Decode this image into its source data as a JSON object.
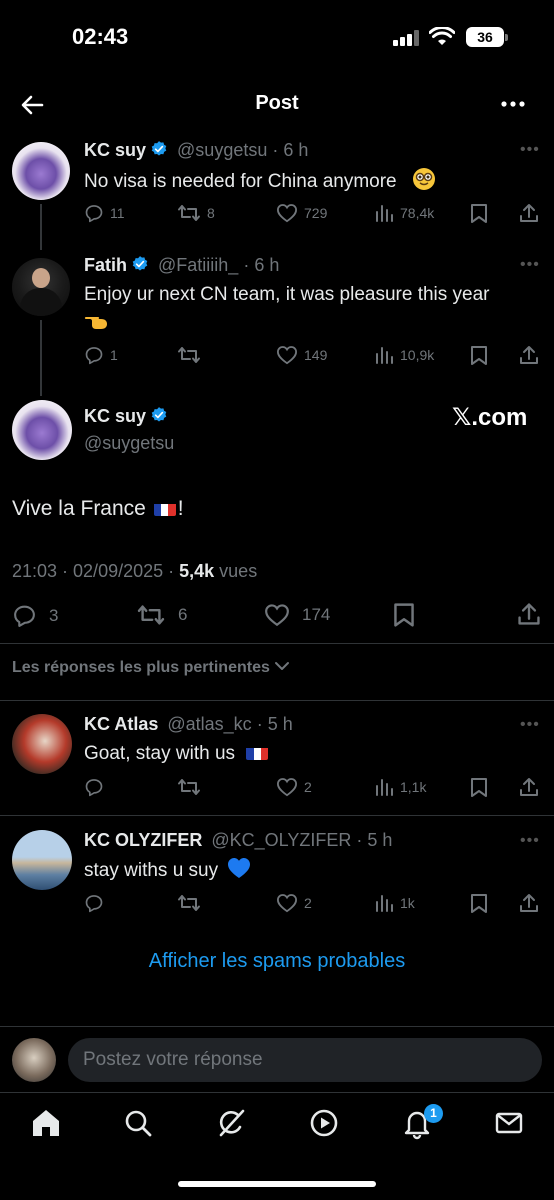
{
  "status_bar": {
    "time": "02:43",
    "battery": "36"
  },
  "header": {
    "title": "Post"
  },
  "colors": {
    "accent": "#1d9bf0",
    "background": "#000000",
    "muted": "#71767b"
  },
  "thread": [
    {
      "name": "KC suy",
      "handle": "@suygetsu",
      "time": "· 6 h",
      "text": "No visa is needed for China anymore",
      "emoji_icon": "nerd-face-icon",
      "stats": {
        "replies": "11",
        "reposts": "8",
        "likes": "729",
        "views": "78,4k"
      }
    },
    {
      "name": "Fatih",
      "handle": "@Fatiiiih_",
      "time": "· 6 h",
      "text": "Enjoy ur next CN team, it was pleasure this year",
      "emoji_icon": "pointing-hand-icon",
      "stats": {
        "replies": "1",
        "reposts": "",
        "likes": "149",
        "views": "10,9k"
      }
    }
  ],
  "main_post": {
    "name": "KC suy",
    "handle": "@suygetsu",
    "watermark": "𝕏.com",
    "text_before": "Vive la France",
    "text_after": "!",
    "timestamp": "21:03 · 02/09/2025 · ",
    "views_count": "5,4k",
    "views_label": " vues",
    "stats": {
      "replies": "3",
      "reposts": "6",
      "likes": "174"
    }
  },
  "sort_label": "Les réponses les plus pertinentes",
  "replies": [
    {
      "name": "KC Atlas",
      "handle": "@atlas_kc",
      "time": "· 5 h",
      "text": "Goat, stay with us",
      "stats": {
        "replies": "",
        "reposts": "",
        "likes": "2",
        "views": "1,1k"
      }
    },
    {
      "name": "KC OLYZIFER",
      "handle": "@KC_OLYZIFER",
      "time": "· 5 h",
      "text": "stay withs u suy",
      "stats": {
        "replies": "",
        "reposts": "",
        "likes": "2",
        "views": "1k"
      }
    }
  ],
  "spam_link": "Afficher les spams probables",
  "reply_placeholder": "Postez votre réponse",
  "nav": {
    "notifications_badge": "1"
  }
}
